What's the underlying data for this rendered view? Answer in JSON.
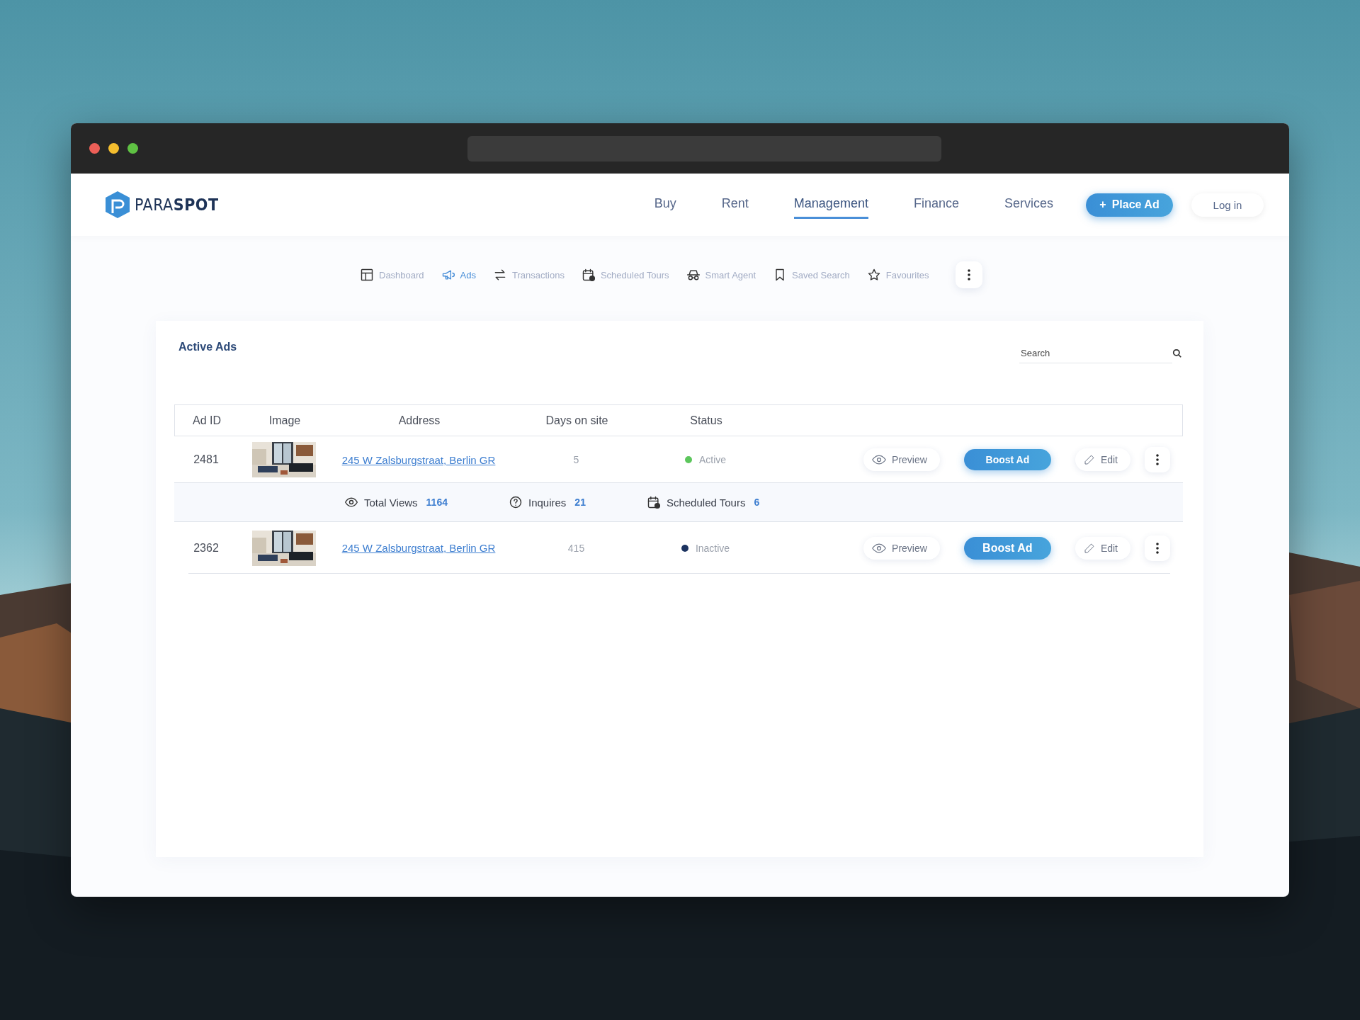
{
  "header": {
    "logo": {
      "part1": "PARA",
      "part2": "SPOT"
    },
    "nav": [
      {
        "label": "Buy",
        "selected": false
      },
      {
        "label": "Rent",
        "selected": false
      },
      {
        "label": "Management",
        "selected": true
      },
      {
        "label": "Finance",
        "selected": false
      },
      {
        "label": "Services",
        "selected": false
      }
    ],
    "place_ad": {
      "icon": "+",
      "label": "Place Ad"
    },
    "login": "Log in"
  },
  "subnav": [
    {
      "kind": "dashboard",
      "label": "Dashboard",
      "selected": false
    },
    {
      "kind": "ads",
      "label": "Ads",
      "selected": true
    },
    {
      "kind": "transactions",
      "label": "Transactions",
      "selected": false
    },
    {
      "kind": "tours",
      "label": "Scheduled Tours",
      "selected": false
    },
    {
      "kind": "agent",
      "label": "Smart Agent",
      "selected": false
    },
    {
      "kind": "saved",
      "label": "Saved Search",
      "selected": false
    },
    {
      "kind": "favourites",
      "label": "Favourites",
      "selected": false
    }
  ],
  "card": {
    "title": "Active Ads",
    "search": {
      "placeholder": "Search"
    },
    "columns": [
      "Ad ID",
      "Image",
      "Address",
      "Days on site",
      "Status"
    ],
    "rows": [
      {
        "id": "2481",
        "address": "245 W Zalsburgstraat, Berlin GR",
        "days": "5",
        "status": "Active",
        "color": "#5cc65c",
        "expanded": true,
        "stats": [
          {
            "kind": "views",
            "label": "Total Views",
            "value": "1164"
          },
          {
            "kind": "inquiries",
            "label": "Inquires",
            "value": "21"
          },
          {
            "kind": "tours",
            "label": "Scheduled Tours",
            "value": "6"
          }
        ],
        "actions": {
          "preview": "Preview",
          "boost": "Boost Ad",
          "edit": "Edit"
        }
      },
      {
        "id": "2362",
        "address": "245 W Zalsburgstraat, Berlin GR",
        "days": "415",
        "status": "Inactive",
        "color": "#1c3360",
        "expanded": false,
        "stats": [],
        "actions": {
          "preview": "Preview",
          "boost": "Boost Ad",
          "edit": "Edit"
        }
      }
    ]
  }
}
